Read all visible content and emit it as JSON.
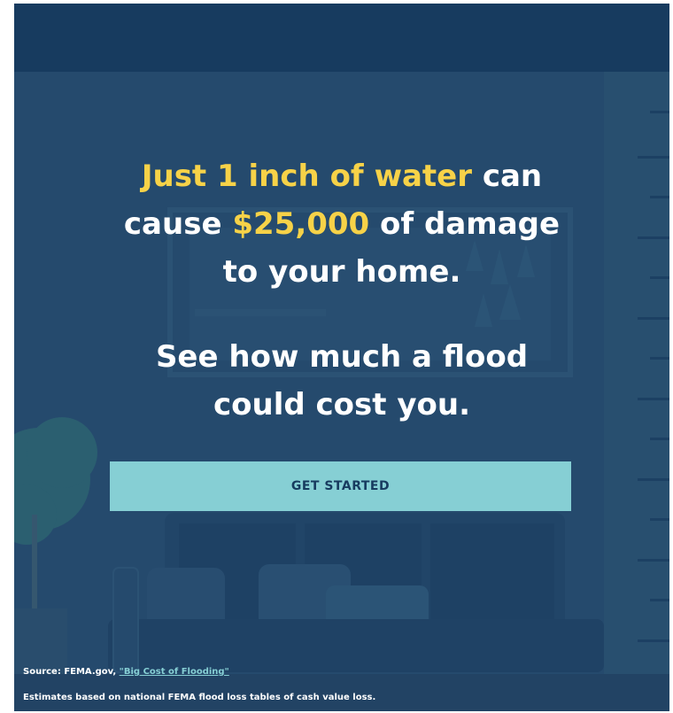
{
  "headline": {
    "part1": "Just 1 inch of water",
    "part2": " can cause ",
    "part3": "$25,000",
    "part4": " of damage to your home."
  },
  "subheadline": "See how much a flood could cost you.",
  "cta": {
    "label": "GET STARTED"
  },
  "footer": {
    "source_prefix": "Source: FEMA.gov, ",
    "source_link": "\"Big Cost of Flooding\"",
    "note": "Estimates based on national FEMA flood loss tables of cash value loss."
  },
  "icons": [
    "houseplant-icon",
    "sofa-illustration",
    "window-illustration",
    "measurement-ruler"
  ],
  "colors": {
    "background": "#264a6e",
    "header": "#173b5f",
    "highlight": "#f7d248",
    "button": "#86cfd4",
    "button_text": "#173b5f"
  }
}
